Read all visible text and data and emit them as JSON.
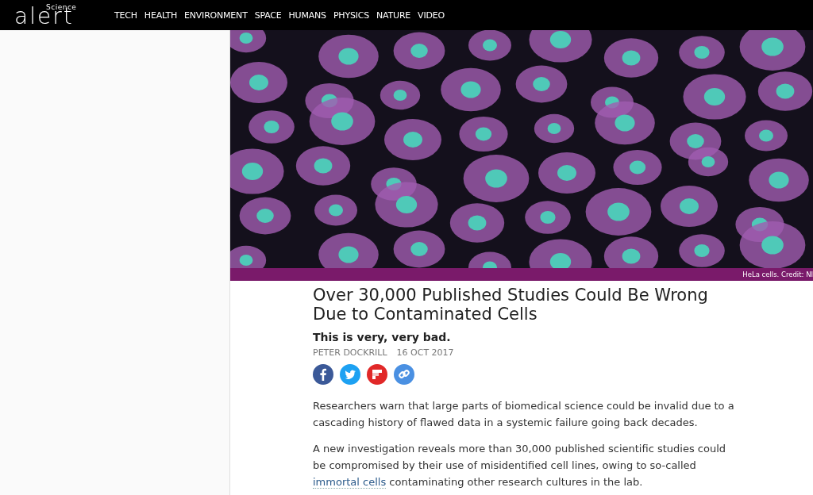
{
  "header": {
    "logo_small": "Science",
    "logo_large": "alert",
    "nav": [
      "TECH",
      "HEALTH",
      "ENVIRONMENT",
      "SPACE",
      "HUMANS",
      "PHYSICS",
      "NATURE",
      "VIDEO"
    ]
  },
  "hero": {
    "caption": "HeLa cells. Credit: NI"
  },
  "article": {
    "title": "Over 30,000 Published Studies Could Be Wrong Due to Contaminated Cells",
    "subtitle": "This is very, very bad.",
    "author": "PETER DOCKRILL",
    "date": "16 OCT 2017",
    "share": [
      {
        "kind": "facebook",
        "color": "#3b5998"
      },
      {
        "kind": "twitter",
        "color": "#1da1f2"
      },
      {
        "kind": "flipboard",
        "color": "#e12828"
      },
      {
        "kind": "link",
        "color": "#4a90e2"
      }
    ],
    "paragraphs": [
      [
        {
          "text": "Researchers warn that large parts of biomedical science could be invalid due to a cascading history of flawed data in a systemic failure going back decades.",
          "link": false
        }
      ],
      [
        {
          "text": "A new investigation reveals more than 30,000 published scientific studies could be compromised by their use of misidentified cell lines, owing to so-called ",
          "link": false
        },
        {
          "text": "immortal cells",
          "link": true
        },
        {
          "text": " contaminating other research cultures in the lab.",
          "link": false
        }
      ]
    ]
  }
}
